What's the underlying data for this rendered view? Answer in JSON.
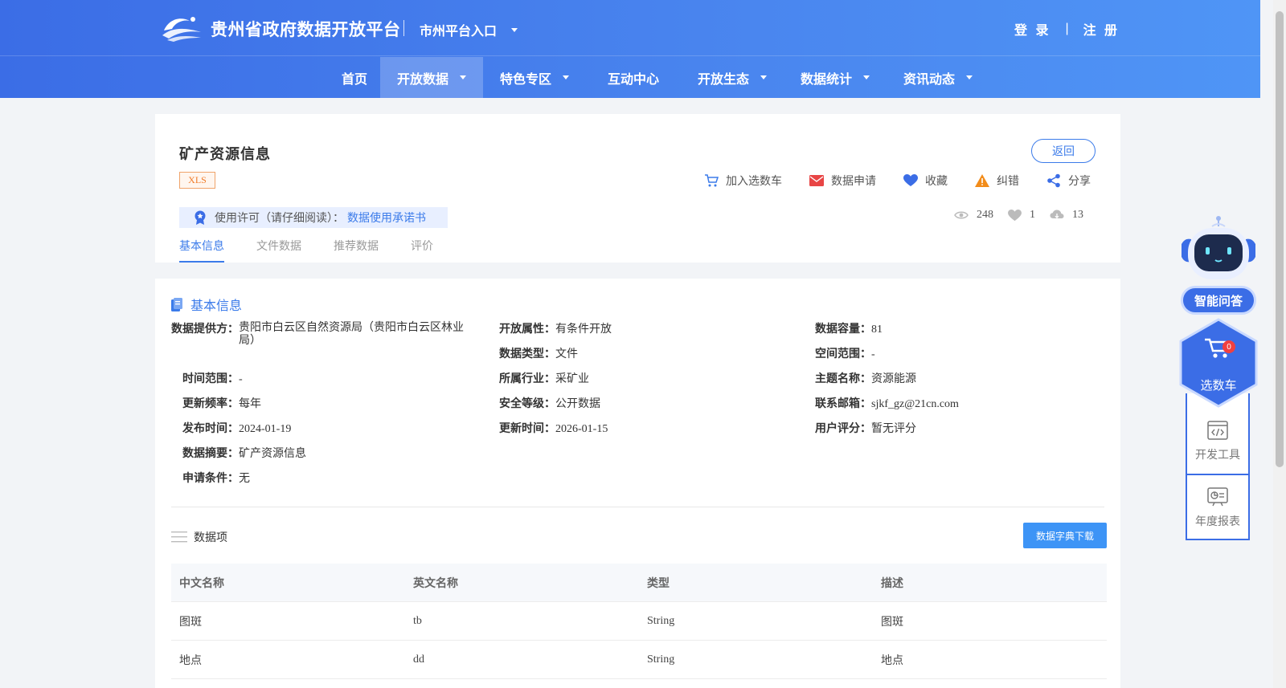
{
  "header": {
    "site_title": "贵州省政府数据开放平台",
    "city_entry": "市州平台入口",
    "login": "登 录",
    "register": "注 册",
    "auth_separator": "|"
  },
  "nav": [
    {
      "label": "首页",
      "dropdown": false,
      "active": false
    },
    {
      "label": "开放数据",
      "dropdown": true,
      "active": true
    },
    {
      "label": "特色专区",
      "dropdown": true,
      "active": false
    },
    {
      "label": "互动中心",
      "dropdown": false,
      "active": false
    },
    {
      "label": "开放生态",
      "dropdown": true,
      "active": false
    },
    {
      "label": "数据统计",
      "dropdown": true,
      "active": false
    },
    {
      "label": "资讯动态",
      "dropdown": true,
      "active": false
    }
  ],
  "dataset": {
    "title": "矿产资源信息",
    "format_tag": "XLS",
    "back_label": "返回",
    "actions": {
      "cart": "加入选数车",
      "apply": "数据申请",
      "favorite": "收藏",
      "report": "纠错",
      "share": "分享"
    },
    "license_label": "使用许可（请仔细阅读）：",
    "license_link": "数据使用承诺书",
    "stats": {
      "views": "248",
      "likes": "1",
      "downloads": "13"
    },
    "tabs": [
      "基本信息",
      "文件数据",
      "推荐数据",
      "评价"
    ]
  },
  "basic_info": {
    "section_title": "基本信息",
    "provider_label": "数据提供方：",
    "provider_value": "贵阳市白云区自然资源局（贵阳市白云区林业局）",
    "open_attr_label": "开放属性：",
    "open_attr_value": "有条件开放",
    "capacity_label": "数据容量：",
    "capacity_value": "81",
    "data_type_label": "数据类型：",
    "data_type_value": "文件",
    "space_label": "空间范围：",
    "space_value": "-",
    "time_label": "时间范围：",
    "time_value": "-",
    "industry_label": "所属行业：",
    "industry_value": "采矿业",
    "topic_label": "主题名称：",
    "topic_value": "资源能源",
    "freq_label": "更新频率：",
    "freq_value": "每年",
    "security_label": "安全等级：",
    "security_value": "公开数据",
    "email_label": "联系邮箱：",
    "email_value": "sjkf_gz@21cn.com",
    "publish_label": "发布时间：",
    "publish_value": "2024-01-19",
    "update_label": "更新时间：",
    "update_value": "2026-01-15",
    "rating_label": "用户评分：",
    "rating_value": "暂无评分",
    "summary_label": "数据摘要：",
    "summary_value": "矿产资源信息",
    "condition_label": "申请条件：",
    "condition_value": "无"
  },
  "data_items": {
    "title": "数据项",
    "download_label": "数据字典下载",
    "columns": [
      "中文名称",
      "英文名称",
      "类型",
      "描述"
    ],
    "rows": [
      [
        "图斑",
        "tb",
        "String",
        "图斑"
      ],
      [
        "地点",
        "dd",
        "String",
        "地点"
      ]
    ]
  },
  "float_widget": {
    "ai_label": "智能问答",
    "cart_label": "选数车",
    "cart_count": "0",
    "dev_tools": "开发工具",
    "annual_report": "年度报表"
  },
  "colors": {
    "brand": "#3b6de6",
    "accent": "#3b7bea",
    "download_button": "#3d94f6",
    "format_tag": "#f07c2a"
  }
}
